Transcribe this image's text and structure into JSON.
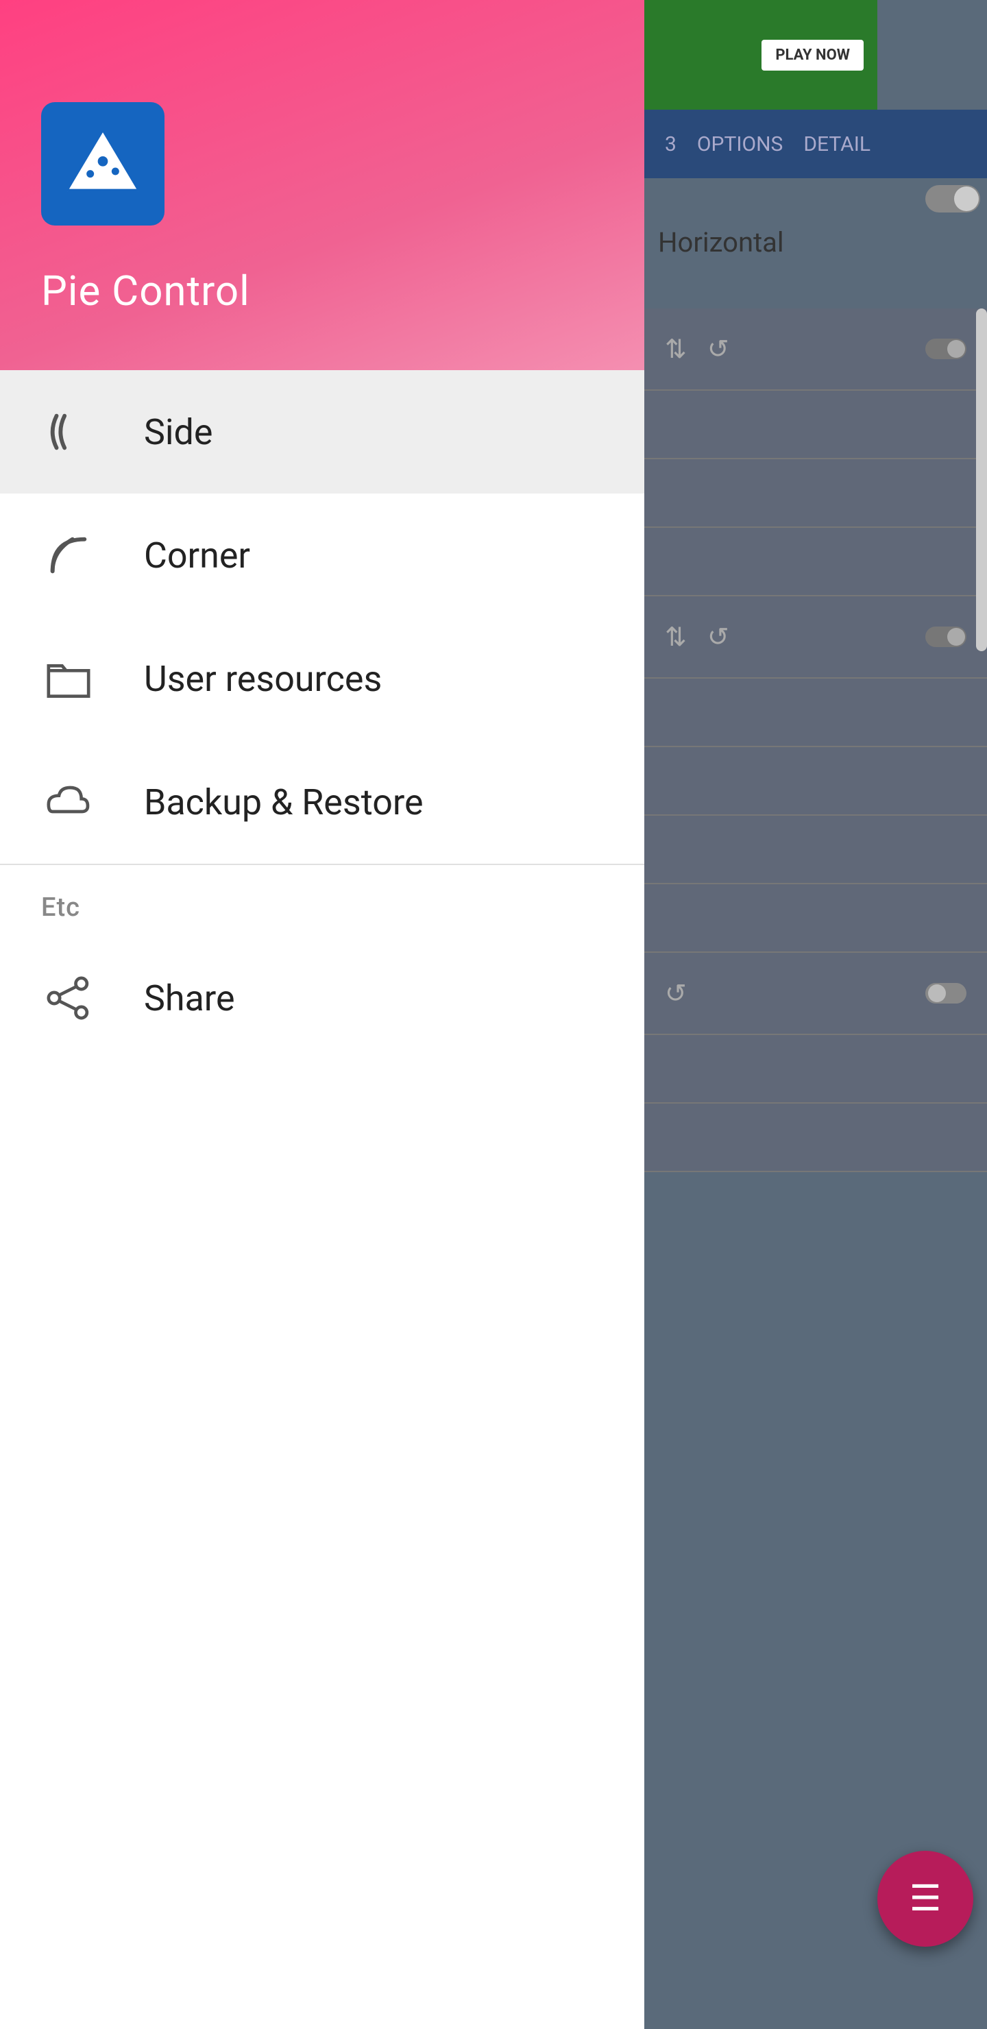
{
  "app": {
    "name": "Pie Control",
    "icon_label": "pizza-icon"
  },
  "drawer": {
    "menu_items": [
      {
        "id": "side",
        "label": "Side",
        "icon": "side-icon",
        "active": true
      },
      {
        "id": "corner",
        "label": "Corner",
        "icon": "corner-icon",
        "active": false
      },
      {
        "id": "user-resources",
        "label": "User resources",
        "icon": "folder-icon",
        "active": false
      },
      {
        "id": "backup-restore",
        "label": "Backup & Restore",
        "icon": "cloud-icon",
        "active": false
      }
    ],
    "sections": [
      {
        "id": "etc",
        "header": "Etc",
        "items": [
          {
            "id": "share",
            "label": "Share",
            "icon": "share-icon",
            "active": false
          }
        ]
      }
    ]
  },
  "right_panel": {
    "tabs": [
      "3",
      "OPTIONS",
      "DETAIL"
    ],
    "label_horizontal": "Horizontal"
  },
  "ad": {
    "play_label": "PLAY NOW"
  },
  "fab": {
    "icon": "menu-icon",
    "label": "≡"
  }
}
